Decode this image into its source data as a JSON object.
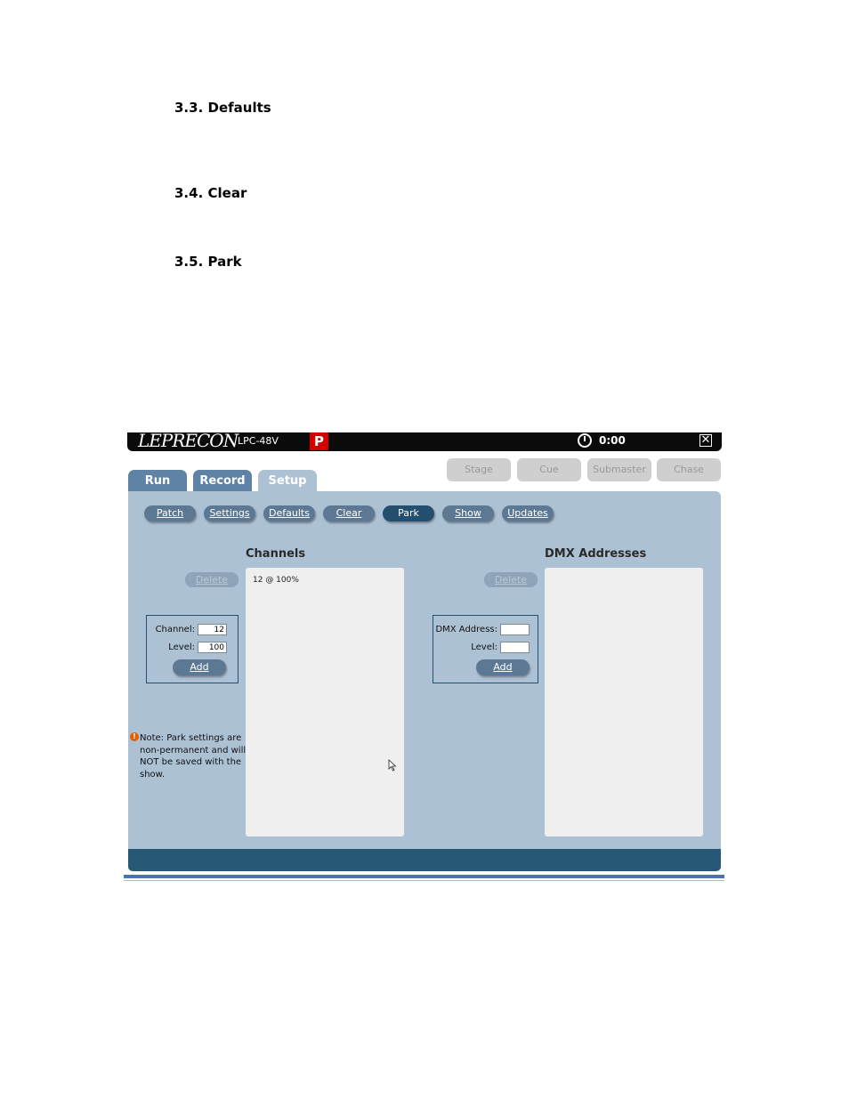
{
  "headings": [
    "3.3. Defaults",
    "3.4. Clear",
    "3.5. Park"
  ],
  "app": {
    "logo": "LEPRECON",
    "model": "LPC-48V",
    "badge": "P",
    "timer": "0:00",
    "main_tabs": [
      "Run",
      "Record",
      "Setup"
    ],
    "mode_buttons": [
      "Stage",
      "Cue",
      "Submaster",
      "Chase"
    ],
    "sub_tabs": [
      "Patch",
      "Settings",
      "Defaults",
      "Clear",
      "Park",
      "Show",
      "Updates"
    ],
    "active_sub_tab": "Park",
    "channels": {
      "title": "Channels",
      "delete_label": "Delete",
      "items": [
        "12 @ 100%"
      ],
      "channel_label": "Channel:",
      "channel_value": "12",
      "level_label": "Level:",
      "level_value": "100",
      "add_label": "Add"
    },
    "dmx": {
      "title": "DMX Addresses",
      "delete_label": "Delete",
      "address_label": "DMX Address:",
      "address_value": "",
      "level_label": "Level:",
      "level_value": "",
      "add_label": "Add"
    },
    "note": "Note: Park settings are non-permanent and will NOT be saved with the show."
  },
  "colors": {
    "panel": "#adc1d4",
    "tab_inactive": "#5f83a4",
    "active_button": "#234e6e",
    "bottom_bar": "#285878",
    "badge": "#d40000"
  }
}
